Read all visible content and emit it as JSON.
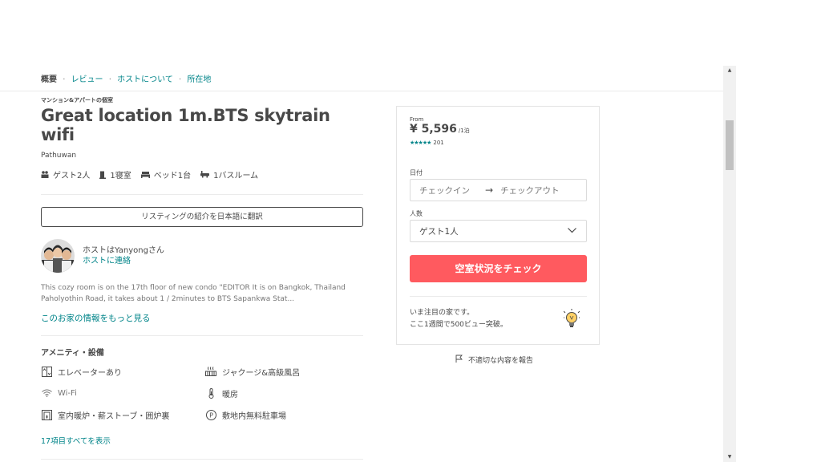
{
  "subnav": {
    "active": "概要",
    "sep": "·",
    "links": [
      "レビュー",
      "ホストについて",
      "所在地"
    ]
  },
  "listing": {
    "kicker": "マンション&アパートの個室",
    "title": "Great location 1m.BTS skytrain wifi",
    "location": "Pathuwan",
    "specs": [
      "ゲスト2人",
      "1寝室",
      "ベッド1台",
      "1バスルーム"
    ],
    "translate_label": "リスティングの紹介を日本語に翻訳",
    "host_name": "ホストはYanyongさん",
    "host_contact": "ホストに連絡",
    "description": "This cozy room is on the 17th floor of new condo \"EDITOR It is on Bangkok, Thailand Paholyothin Road, it takes about 1 / 2minutes to BTS Sapankwa Stat...",
    "more_link": "このお家の情報をもっと見る",
    "amenities_title": "アメニティ・設備",
    "amenities": [
      {
        "label": "エレベーターあり",
        "icon": "elevator-icon",
        "available": true
      },
      {
        "label": "ジャクージ&高級風呂",
        "icon": "jacuzzi-icon",
        "available": true
      },
      {
        "label": "Wi-Fi",
        "icon": "wifi-icon",
        "available": false
      },
      {
        "label": "暖房",
        "icon": "thermometer-icon",
        "available": true
      },
      {
        "label": "室内暖炉・薪ストーブ・囲炉裏",
        "icon": "fireplace-icon",
        "available": true
      },
      {
        "label": "敷地内無料駐車場",
        "icon": "parking-icon",
        "available": true
      }
    ],
    "show_all": "17項目すべてを表示"
  },
  "booking": {
    "from": "From",
    "price": "¥ 5,596",
    "per": "/1泊",
    "stars": "★★★★★",
    "review_count": "201",
    "date_label": "日付",
    "checkin_placeholder": "チェックイン",
    "arrow": "→",
    "checkout_placeholder": "チェックアウト",
    "guests_label": "人数",
    "guests_value": "ゲスト1人",
    "cta": "空室状況をチェック",
    "hot_line1": "いま注目の家です。",
    "hot_line2": "ここ1週間で500ビュー突破。"
  },
  "report": "不適切な内容を報告",
  "colors": {
    "accent": "#008489",
    "cta": "#ff5a5f",
    "text": "#484848"
  }
}
